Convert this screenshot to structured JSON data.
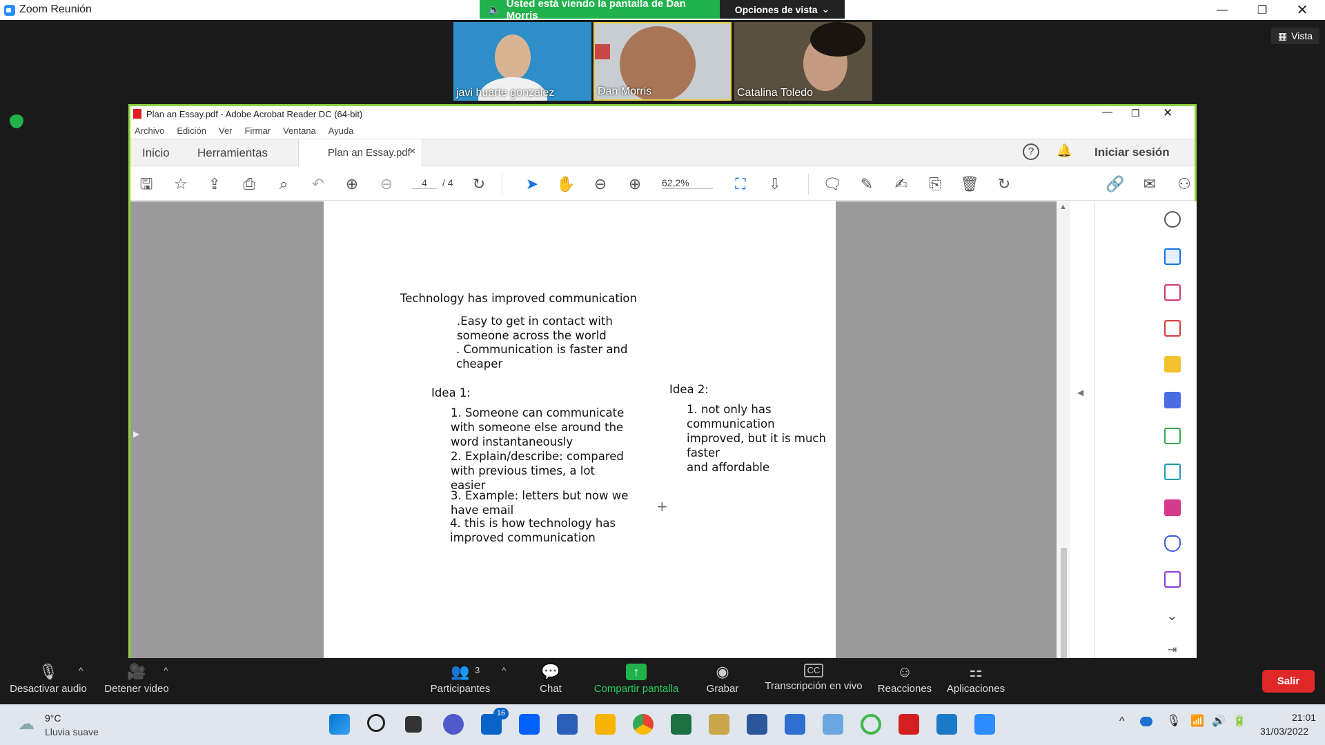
{
  "zoom": {
    "window_title": "Zoom Reunión",
    "share_banner": "Usted está viendo la pantalla de Dan Morris",
    "view_options": "Opciones de vista",
    "vista": "Vista",
    "participants": [
      {
        "name": "javi huarte gonzalez"
      },
      {
        "name": "Dan Morris"
      },
      {
        "name": "Catalina Toledo"
      }
    ],
    "controls": {
      "mute": "Desactivar audio",
      "video": "Detener video",
      "participants": "Participantes",
      "participants_count": "3",
      "chat": "Chat",
      "share": "Compartir pantalla",
      "record": "Grabar",
      "captions": "Transcripción en vivo",
      "reactions": "Reacciones",
      "apps": "Aplicaciones",
      "leave": "Salir"
    },
    "colors": {
      "share_green": "#22b24c",
      "leave_red": "#e02828"
    }
  },
  "acrobat": {
    "title": "Plan an Essay.pdf - Adobe Acrobat Reader DC (64-bit)",
    "menu": [
      "Archivo",
      "Edición",
      "Ver",
      "Firmar",
      "Ventana",
      "Ayuda"
    ],
    "tabs": {
      "home": "Inicio",
      "tools": "Herramientas",
      "doc": "Plan an Essay.pdf",
      "signin": "Iniciar sesión"
    },
    "page_current": "4",
    "page_total": "/ 4",
    "zoom": "62,2%"
  },
  "document": {
    "heading": "Technology has improved communication",
    "point1": ".Easy to get in contact with\nsomeone across the world",
    "point2": ". Communication is faster and\ncheaper",
    "idea1_title": "Idea 1:",
    "idea1_items": [
      "1. Someone can communicate\nwith someone else around the\nword instantaneously",
      "2. Explain/describe: compared\nwith previous times, a lot\neasier",
      "3. Example: letters but now we\nhave email",
      "4. this is how technology has\nimproved communication"
    ],
    "idea2_title": "Idea 2:",
    "idea2_item": "1. not only has communication\nimproved, but it is much faster\nand affordable"
  },
  "taskbar": {
    "temp": "9°C",
    "weather": "Lluvia suave",
    "mail_badge": "16",
    "time": "21:01",
    "date": "31/03/2022"
  }
}
